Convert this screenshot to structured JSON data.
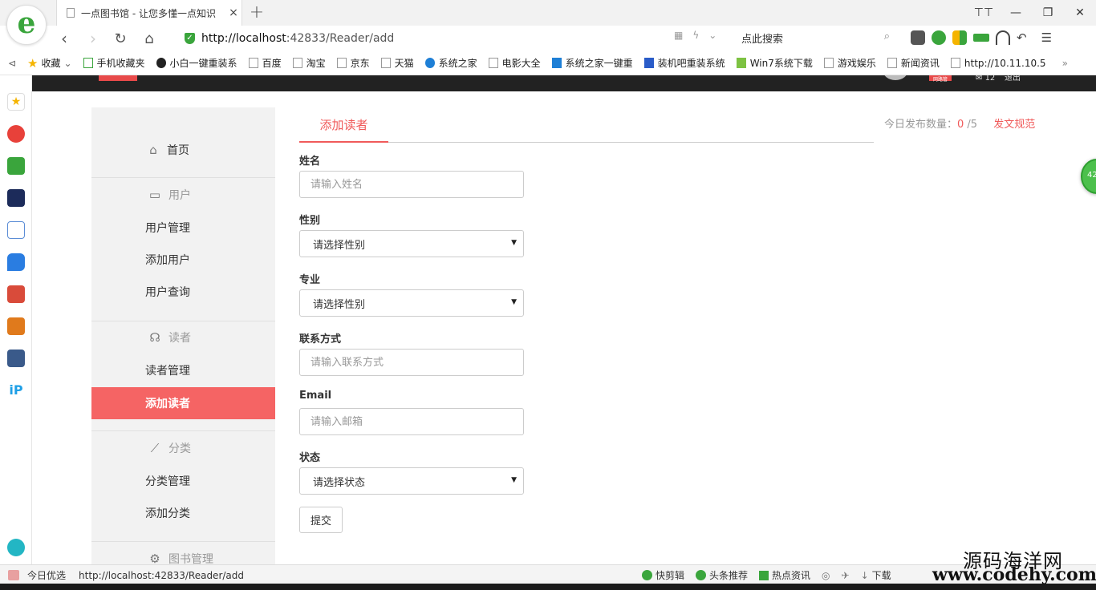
{
  "browser": {
    "logo_letter": "e",
    "tab_title": "一点图书馆 - 让您多懂一点知识",
    "tab_close": "×",
    "new_tab": "+",
    "url_host": "http://localhost",
    "url_rest": ":42833/Reader/add",
    "search_placeholder": "点此搜索",
    "win_controls": [
      "⊤⊤",
      "—",
      "❐",
      "✕"
    ]
  },
  "bookmarks": [
    {
      "label": "收藏",
      "icon": "star-icon"
    },
    {
      "label": "手机收藏夹",
      "icon": "phone-icon"
    },
    {
      "label": "小白一键重装系",
      "icon": "site-icon"
    },
    {
      "label": "百度",
      "icon": "page-icon"
    },
    {
      "label": "淘宝",
      "icon": "page-icon"
    },
    {
      "label": "京东",
      "icon": "page-icon"
    },
    {
      "label": "天猫",
      "icon": "page-icon"
    },
    {
      "label": "系统之家",
      "icon": "site-icon"
    },
    {
      "label": "电影大全",
      "icon": "page-icon"
    },
    {
      "label": "系统之家一键重",
      "icon": "site-icon"
    },
    {
      "label": "装机吧重装系统",
      "icon": "site-icon"
    },
    {
      "label": "Win7系统下载",
      "icon": "site-icon"
    },
    {
      "label": "游戏娱乐",
      "icon": "page-icon"
    },
    {
      "label": "新闻资讯",
      "icon": "page-icon"
    },
    {
      "label": "http://10.11.10.5",
      "icon": "page-icon"
    }
  ],
  "header": {
    "badge": "网路管",
    "msg": "12",
    "logout": "退出"
  },
  "menu": {
    "home": "首页",
    "user_group": "用户",
    "user_manage": "用户管理",
    "user_add": "添加用户",
    "user_query": "用户查询",
    "reader_group": "读者",
    "reader_manage": "读者管理",
    "reader_add": "添加读者",
    "category_group": "分类",
    "category_manage": "分类管理",
    "category_add": "添加分类",
    "book_group": "图书管理"
  },
  "form": {
    "tab_label": "添加读者",
    "daily_label": "今日发布数量：",
    "daily_num": "0",
    "daily_total": " /5",
    "rules_link": "发文规范",
    "name_label": "姓名",
    "name_placeholder": "请输入姓名",
    "gender_label": "性别",
    "gender_selected": "请选择性别",
    "major_label": "专业",
    "major_selected": "请选择性别",
    "contact_label": "联系方式",
    "contact_placeholder": "请输入联系方式",
    "email_label": "Email",
    "email_placeholder": "请输入邮箱",
    "status_label": "状态",
    "status_selected": "请选择状态",
    "submit": "提交"
  },
  "float_ball": "42",
  "statusbar": {
    "picks": "今日优选",
    "url": "http://localhost:42833/Reader/add",
    "items": [
      "快剪辑",
      "头条推荐",
      "热点资讯",
      "下载"
    ]
  },
  "watermark": {
    "cn": "源码海洋网",
    "en": "www.codehy.com"
  }
}
